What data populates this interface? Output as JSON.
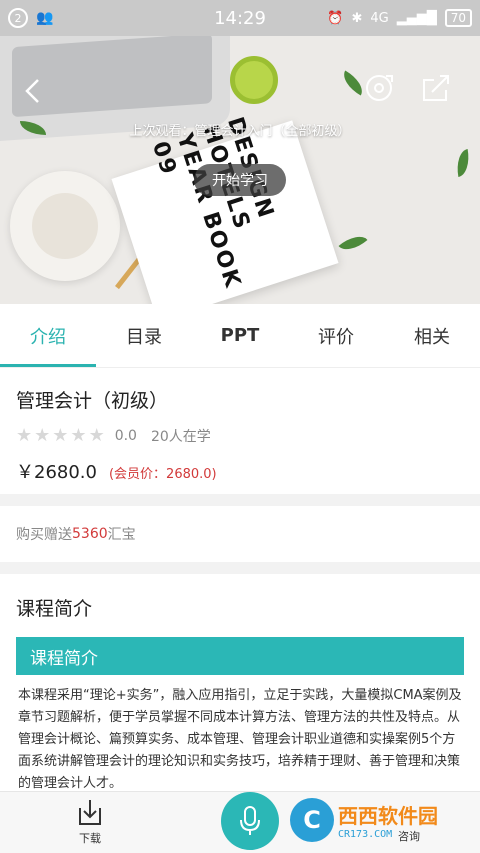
{
  "status_bar": {
    "notification_count": "2",
    "time": "14:29",
    "network": "4G",
    "battery": "70"
  },
  "hero": {
    "book_text": "DESIGN HOTELS YEAR BOOK 09",
    "last_watched": "上次观看：管理会计入门（全部初级）",
    "start_button": "开始学习"
  },
  "tabs": [
    {
      "label": "介绍",
      "active": true
    },
    {
      "label": "目录",
      "active": false
    },
    {
      "label": "PPT",
      "active": false
    },
    {
      "label": "评价",
      "active": false
    },
    {
      "label": "相关",
      "active": false
    }
  ],
  "course": {
    "title": "管理会计（初级）",
    "rating": "0.0",
    "learners": "20人在学",
    "price": "￥2680.0",
    "member_price": "(会员价：2680.0)"
  },
  "gift": {
    "prefix": "购买赠送",
    "amount": "5360",
    "suffix": "汇宝"
  },
  "intro": {
    "heading": "课程简介",
    "bar_title": "课程简介",
    "text": "本课程采用“理论+实务”，融入应用指引，立足于实践，大量模拟CMA案例及章节习题解析，便于学员掌握不同成本计算方法、管理方法的共性及特点。从管理会计概论、篇预算实务、成本管理、管理会计职业道德和实操案例5个方面系统讲解管理会计的理论知识和实务技巧，培养精于理财、善于管理和决策的管理会计人才。"
  },
  "bottom": {
    "download_label": "下载",
    "consult_label": "咨询"
  },
  "watermark": {
    "cn": "西西软件园",
    "en": "CR173.COM"
  },
  "colors": {
    "accent": "#2bb7b6",
    "price_red": "#d23a3a"
  }
}
